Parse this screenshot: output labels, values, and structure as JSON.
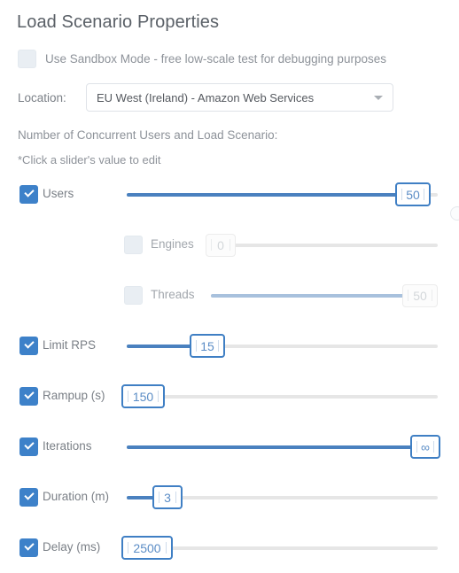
{
  "page": {
    "title": "Load Scenario Properties"
  },
  "sandbox": {
    "label": "Use Sandbox Mode - free low-scale test for debugging purposes",
    "checked": false
  },
  "location": {
    "label": "Location:",
    "value": "EU West (Ireland) - Amazon Web Services",
    "caret_icon": "chevron-down-icon"
  },
  "hints": {
    "section_label": "Number of Concurrent Users and Load Scenario:",
    "edit_note": "*Click a slider's value to edit"
  },
  "colors": {
    "accent": "#3d81c9",
    "fill": "#4a81bf",
    "fill_disabled": "#a8c1dd",
    "track": "#e6e6e6",
    "text": "#7b8087",
    "title": "#5a6067"
  },
  "sliders": [
    {
      "id": "users",
      "label": "Users",
      "value": "50",
      "checked": true,
      "enabled": true,
      "fill_pct": 92,
      "indent": 0
    },
    {
      "id": "engines",
      "label": "Engines",
      "value": "0",
      "checked": false,
      "enabled": false,
      "fill_pct": 0,
      "indent": 1
    },
    {
      "id": "threads",
      "label": "Threads",
      "value": "50",
      "checked": false,
      "enabled": false,
      "fill_pct": 92,
      "indent": 1
    },
    {
      "id": "limit-rps",
      "label": "Limit RPS",
      "value": "15",
      "checked": true,
      "enabled": true,
      "fill_pct": 26,
      "indent": 0
    },
    {
      "id": "rampup",
      "label": "Rampup (s)",
      "value": "150",
      "checked": true,
      "enabled": true,
      "fill_pct": 5,
      "indent": 0
    },
    {
      "id": "iterations",
      "label": "Iterations",
      "value": "∞",
      "checked": true,
      "enabled": true,
      "fill_pct": 96,
      "indent": 0
    },
    {
      "id": "duration",
      "label": "Duration (m)",
      "value": "3",
      "checked": true,
      "enabled": true,
      "fill_pct": 13,
      "indent": 0
    },
    {
      "id": "delay",
      "label": "Delay (ms)",
      "value": "2500",
      "checked": true,
      "enabled": true,
      "fill_pct": 5,
      "indent": 0
    }
  ]
}
